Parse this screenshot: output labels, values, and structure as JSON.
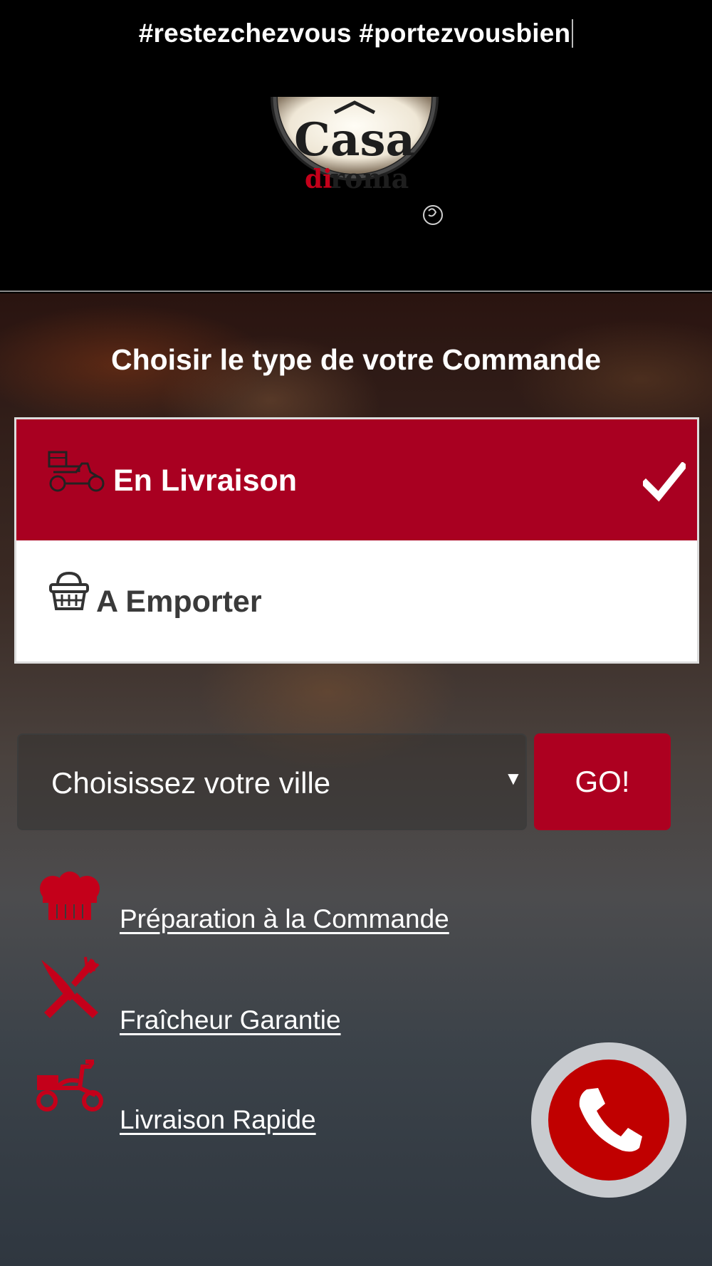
{
  "header": {
    "hashtags": "#restezchezvous #portezvousbien",
    "logo": {
      "line1": "Casa",
      "line2_red": "di",
      "line2_dark": "roma"
    }
  },
  "order": {
    "title": "Choisir le type de votre Commande",
    "options": [
      {
        "label": "En Livraison",
        "icon": "scooter-delivery-icon",
        "selected": true
      },
      {
        "label": "A Emporter",
        "icon": "basket-icon",
        "selected": false
      }
    ]
  },
  "city": {
    "select_value": "Choisissez votre ville",
    "go_label": "GO!"
  },
  "features": [
    {
      "label": "Préparation à la Commande",
      "icon": "chef-hat-icon"
    },
    {
      "label": "Fraîcheur Garantie",
      "icon": "fork-knife-icon"
    },
    {
      "label": "Livraison Rapide",
      "icon": "scooter-icon"
    }
  ],
  "colors": {
    "accent_red": "#a90021",
    "call_red": "#c00000",
    "header_bg": "#000000"
  }
}
